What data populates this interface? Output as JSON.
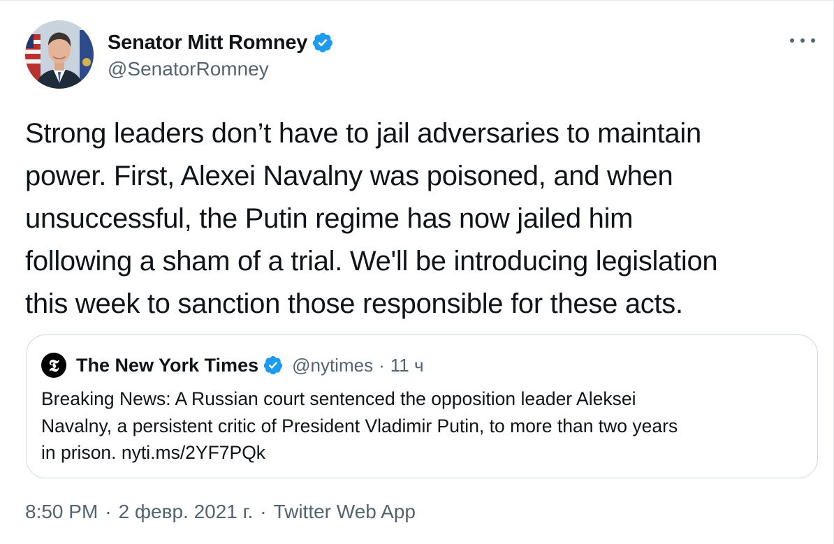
{
  "author": {
    "display_name": "Senator Mitt Romney",
    "handle": "@SenatorRomney",
    "verified": true,
    "avatar_icon": "profile-photo"
  },
  "tweet": {
    "text": "Strong leaders don’t have to jail adversaries to maintain\npower. First, Alexei Navalny was poisoned, and when\nunsuccessful, the Putin regime has now jailed him\nfollowing a sham of a trial. We'll be introducing legislation\nthis week to sanction those responsible for these acts."
  },
  "quoted_tweet": {
    "avatar_glyph": "𝕿",
    "display_name": "The New York Times",
    "handle": "@nytimes",
    "separator": "·",
    "time": "11 ч",
    "text_line1": "Breaking News: A Russian court sentenced the opposition leader Aleksei",
    "text_line2": "Navalny, a persistent critic of President Vladimir Putin, to more than two years",
    "text_line3_prefix": "in prison. ",
    "link": "nyti.ms/2YF7PQk"
  },
  "meta": {
    "time": "8:50 PM",
    "separator": "·",
    "date": "2 февр. 2021 г.",
    "source": "Twitter Web App"
  },
  "colors": {
    "verified_blue": "#1d9bf0",
    "secondary_text": "#536471",
    "primary_text": "#0f1419",
    "border": "#cfd9de"
  },
  "icons": {
    "more": "more-horizontal-icon",
    "verified": "verified-badge-icon"
  }
}
